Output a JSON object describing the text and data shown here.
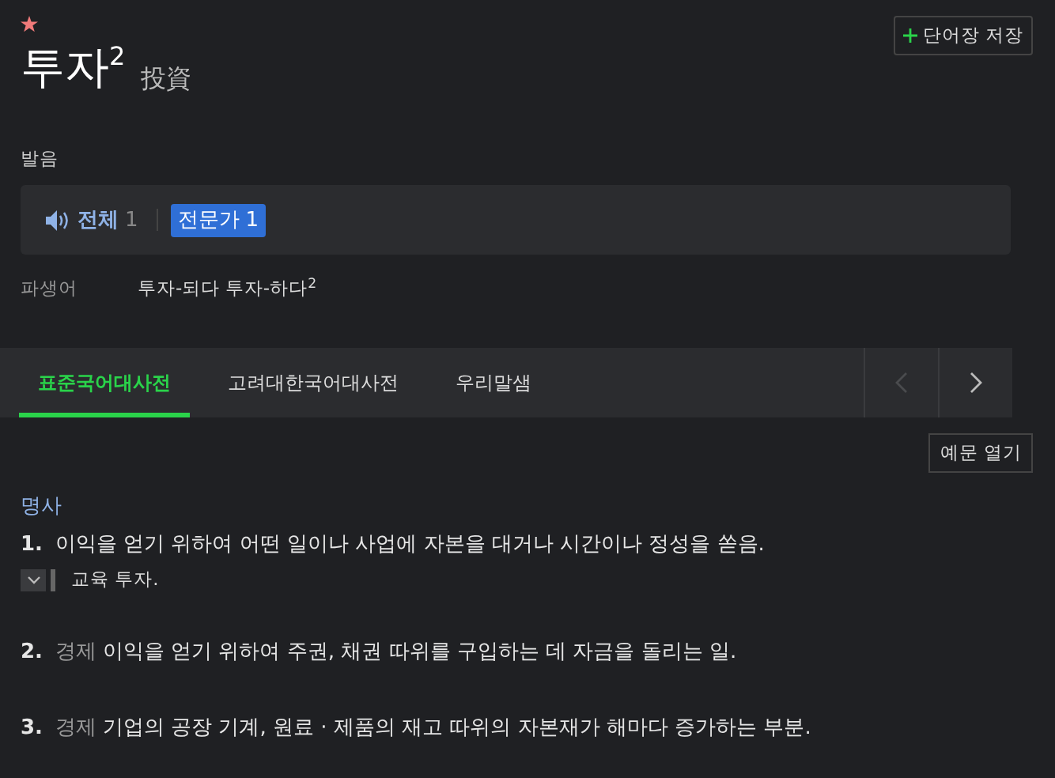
{
  "entry": {
    "starred": true,
    "word": "투자",
    "homograph": "2",
    "hanja": "投資"
  },
  "save_button": {
    "label": "단어장 저장"
  },
  "pronunciation": {
    "label": "발음",
    "options": [
      {
        "label": "전체",
        "count": "1",
        "selected": false
      },
      {
        "label": "전문가",
        "count": "1",
        "selected": true
      }
    ]
  },
  "derivatives": {
    "label": "파생어",
    "items": [
      "투자-되다",
      "투자-하다$^{2}$"
    ]
  },
  "tabs": [
    {
      "label": "표준국어대사전",
      "selected": true
    },
    {
      "label": "고려대한국어대사전",
      "selected": false
    },
    {
      "label": "우리말샘",
      "selected": false
    }
  ],
  "tab_arrows": {
    "prev_disabled": true,
    "next_disabled": false
  },
  "example_button": {
    "label": "예문 열기"
  },
  "part_of_speech": "명사",
  "senses": [
    {
      "number": "1.",
      "text": "이익을 얻기 위하여 어떤 일이나 사업에 자본을 대거나 시간이나 정성을 쏟음.",
      "examples_expanded": false,
      "examples": [
        "교육 투자."
      ]
    },
    {
      "number": "2.",
      "field": "경제",
      "text": "이익을 얻기 위하여 주권, 채권 따위를 구입하는 데 자금을 돌리는 일."
    },
    {
      "number": "3.",
      "field": "경제",
      "text": "기업의 공장 기계, 원료 · 제품의 재고 따위의 자본재가 해마다 증가하는 부분."
    }
  ]
}
